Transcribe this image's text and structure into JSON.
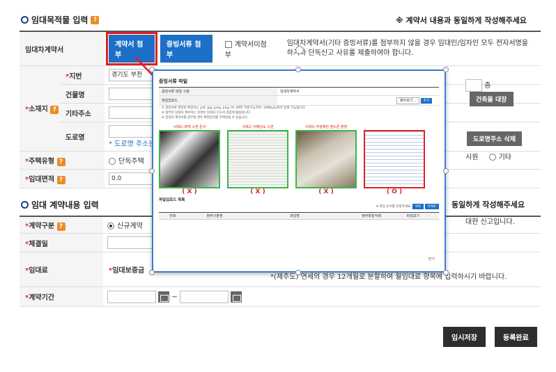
{
  "section1": {
    "title": "임대목적물 입력",
    "notice": "※ 계약서 내용과 동일하게 작성해주세요"
  },
  "section2": {
    "title": "임대 계약내용 입력",
    "notice_fragment": "동일하게 작성해주세요"
  },
  "help_icon": "?",
  "form1": {
    "contract_label": "임대차계약서",
    "attach_contract_btn": "계약서 첨부",
    "attach_proof_btn": "증빙서류 첨부",
    "no_contract_label": "계약서미첨부",
    "contract_note": "임대차계약서(기타 증빙서류)를 첨부하지 않을 경우 임대인/임차인 모두 전자서명을 하거나 단독신고 사유를 제출하여야 합니다.",
    "location_label": "소재지",
    "lot_label": "지번",
    "lot_value": "경기도 부천",
    "building_label": "건물명",
    "floor_suffix": "층",
    "building_ledger_btn": "건축물 대장",
    "other_addr_label": "기타주소",
    "road_label": "도로명",
    "road_note": "* 도로명 주소는",
    "road_delete_btn": "도로명주소 삭제",
    "house_type_label": "주택유형",
    "house_type_options": [
      "단독주택",
      "시원",
      "기타"
    ],
    "area_label": "임대면적",
    "area_value": "0.0"
  },
  "form2": {
    "contract_type_label": "계약구분",
    "contract_type_value": "신규계약",
    "contract_type_note": "대한 신고입니다.",
    "signed_date_label": "체결일",
    "rent_label": "임대료",
    "deposit_label": "임대보증금",
    "rent_note": "*(제주도) 연세의 경우 12개월로 분할하여 월임대료 항목에 입력하시기 바랍니다.",
    "period_label": "계약기간",
    "period_sep": "~"
  },
  "footer": {
    "temp_save_btn": "임시저장",
    "submit_btn": "등록완료"
  },
  "modal": {
    "title": "증빙서류 파일",
    "row_type_key": "증빙서류 파일 구분",
    "row_type_val": "임대차계약서",
    "upload_key": "파일업로드",
    "browse_btn": "찾아보기...",
    "add_btn": "추가",
    "notes": [
      "※ 증빙서류 파일의 확장자는 pdf, jpg, jpeg, png, tif, tiff만 지원가능하며, 10Mbyte까지 등록 가능합니다.",
      "※ 첨부된 임대차 계약서는 작성된 임대차 신고서 검증에 활용됩니다.",
      "※ 임대차 계약서를 첨부할 경우 확정일자를 부여받을 수 있습니다."
    ],
    "samples": [
      {
        "caption": "사례1) 흑백 스캔 문서",
        "mark": "( X )"
      },
      {
        "caption": "사례2) 저해상도 스캔",
        "mark": "( X )"
      },
      {
        "caption": "사례3) 부정확한 핸드폰 촬영",
        "mark": "( X )"
      },
      {
        "caption": "",
        "mark": "( O )"
      }
    ],
    "list_title": "파일업로드 목록",
    "order_note": "※ 파일 순서를 조정하세요.",
    "up_btn": "위로",
    "down_btn": "아래로",
    "columns": [
      "번호",
      "첨부구분명",
      "파일명",
      "첨부파일삭제",
      "파일보기"
    ],
    "close_label": "닫기"
  },
  "colors": {
    "accent_blue": "#1d6fc7",
    "highlight_red": "#e02020",
    "help_orange": "#f08a24"
  }
}
